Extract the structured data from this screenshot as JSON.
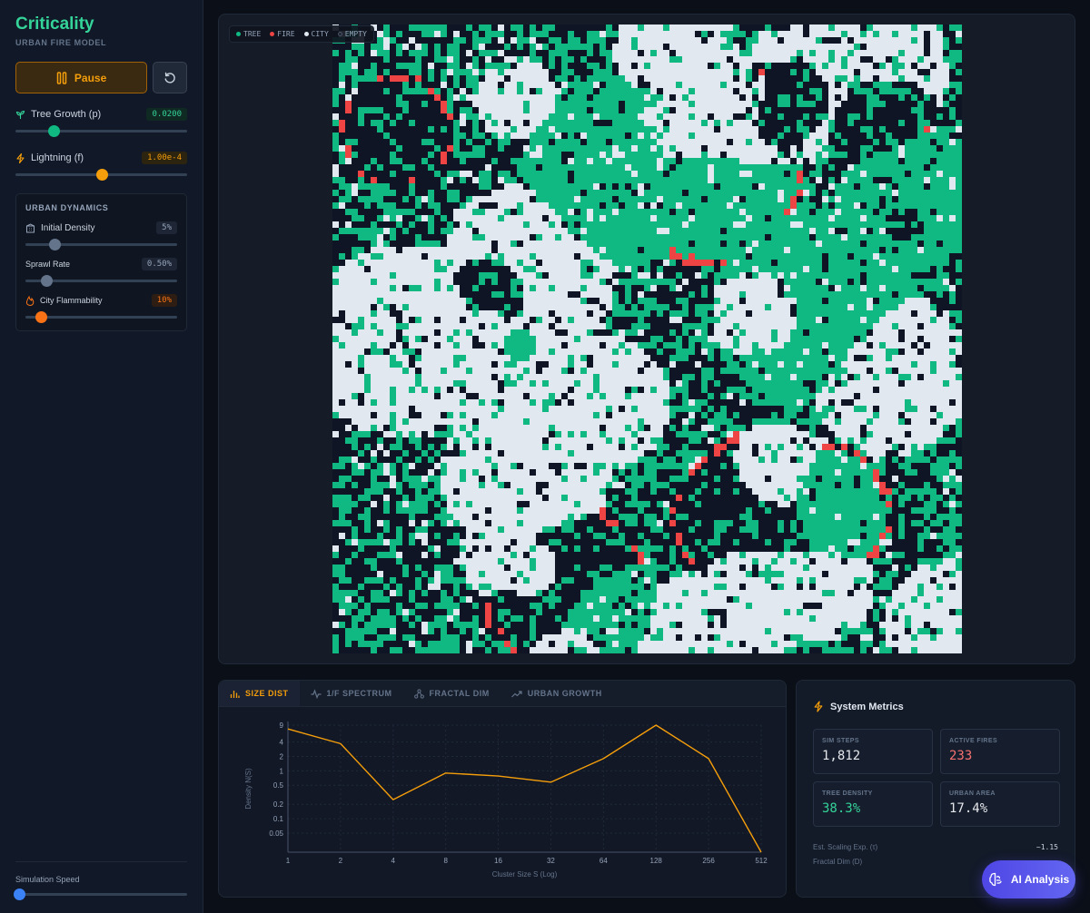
{
  "app": {
    "title": "Criticality",
    "subtitle": "URBAN FIRE MODEL"
  },
  "controls": {
    "pause_label": "Pause",
    "reset_icon": "reset-icon",
    "tree_growth": {
      "label": "Tree Growth (p)",
      "value": "0.0200",
      "level": 0.22
    },
    "lightning": {
      "label": "Lightning (f)",
      "value": "1.00e-4",
      "level": 0.5
    }
  },
  "urban": {
    "title": "URBAN DYNAMICS",
    "initial_density": {
      "label": "Initial Density",
      "value": "5%",
      "level": 0.19
    },
    "sprawl_rate": {
      "label": "Sprawl Rate",
      "value": "0.50%",
      "level": 0.14
    },
    "city_flammability": {
      "label": "City Flammability",
      "value": "10%",
      "level": 0.1
    }
  },
  "speed": {
    "label": "Simulation Speed",
    "level": 0.02
  },
  "legend": {
    "tree": "TREE",
    "fire": "FIRE",
    "city": "CITY",
    "empty": "EMPTY"
  },
  "colors": {
    "tree": "#10b981",
    "fire": "#ef4444",
    "city": "#e2e8f0",
    "empty": "#0f1524",
    "accent": "#f59e0b",
    "brand": "#34d399"
  },
  "tabs": [
    {
      "label": "SIZE DIST",
      "icon": "bar-chart-icon",
      "active": true
    },
    {
      "label": "1/F SPECTRUM",
      "icon": "pulse-icon",
      "active": false
    },
    {
      "label": "FRACTAL DIM",
      "icon": "network-icon",
      "active": false
    },
    {
      "label": "URBAN GROWTH",
      "icon": "trend-icon",
      "active": false
    }
  ],
  "metrics": {
    "title": "System Metrics",
    "sim_steps": {
      "label": "SIM STEPS",
      "value": "1,812"
    },
    "active_fires": {
      "label": "ACTIVE FIRES",
      "value": "233"
    },
    "tree_density": {
      "label": "TREE DENSITY",
      "value": "38.3%"
    },
    "urban_area": {
      "label": "URBAN AREA",
      "value": "17.4%"
    },
    "scaling_label": "Est. Scaling Exp. (τ)",
    "scaling_value": "~1.15",
    "fractal_label": "Fractal Dim (D)"
  },
  "ai_button": "AI Analysis",
  "chart_data": {
    "type": "line",
    "title": "",
    "xlabel": "Cluster Size S (Log)",
    "ylabel": "Density N(S)",
    "x_scale": "log",
    "y_scale": "log",
    "x": [
      1,
      2,
      4,
      8,
      16,
      32,
      64,
      128,
      256,
      512
    ],
    "x_ticks": [
      "1",
      "2",
      "4",
      "8",
      "16",
      "32",
      "64",
      "128",
      "256",
      "512"
    ],
    "y_ticks": [
      "9",
      "4",
      "2",
      "1",
      "0.5",
      "0.2",
      "0.1",
      "0.05"
    ],
    "y_tick_values": [
      9,
      4,
      2,
      1,
      0.5,
      0.2,
      0.1,
      0.05
    ],
    "ylim": [
      0.02,
      9
    ],
    "series": [
      {
        "values": [
          7.5,
          3.7,
          0.25,
          0.9,
          0.78,
          0.58,
          1.8,
          9,
          1.8,
          0.02
        ],
        "color": "#f59e0b"
      }
    ],
    "grid": true
  }
}
